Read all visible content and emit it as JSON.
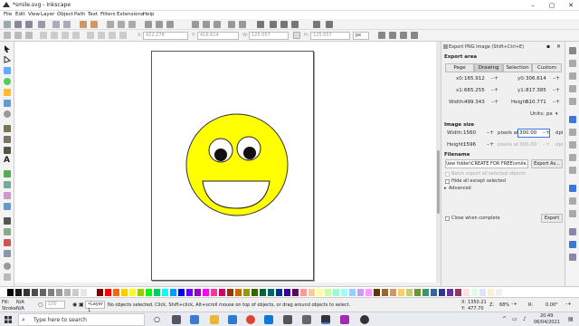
{
  "window": {
    "title": "*smile.svg - Inkscape",
    "min": "–",
    "max": "▢",
    "close": "✕"
  },
  "menu": [
    "File",
    "Edit",
    "View",
    "Layer",
    "Object",
    "Path",
    "Text",
    "Filters",
    "Extensions",
    "Help"
  ],
  "toolctrl": {
    "x": "422.278",
    "y": "416.614",
    "w": "125.057",
    "h": "125.057",
    "unit": "px"
  },
  "panel": {
    "title": "Export PNG Image (Shift+Ctrl+E)",
    "export_area_label": "Export area",
    "area_tabs": [
      "Page",
      "Drawing",
      "Selection",
      "Custom"
    ],
    "x0_label": "x0:",
    "x0": "165.912",
    "y0_label": "y0:",
    "y0": "306.614",
    "x1_label": "x1:",
    "x1": "665.255",
    "y1_label": "y1:",
    "y1": "817.385",
    "width_label": "Width:",
    "width": "499.343",
    "height_label": "Height:",
    "height": "510.771",
    "units_label": "Units:",
    "units": "px",
    "image_size_label": "Image size",
    "img_width_label": "Width:",
    "img_width": "1560",
    "img_height_label": "Height:",
    "img_height": "1596",
    "pixels_at": "pixels at",
    "dpi": "300.00",
    "dpi2": "300.00",
    "dpi_unit": "dpi",
    "filename_label": "Filename",
    "filename": "\\iew folder\\CREATE FOR FREE\\smile.png",
    "export_as": "Export As...",
    "batch_export": "Batch export all selected objects",
    "hide_except": "Hide all except selected",
    "advanced": "Advanced",
    "close_when_complete": "Close when complete",
    "export_btn": "Export"
  },
  "status": {
    "fill_label": "Fill:",
    "fill_val": "N/A",
    "stroke_label": "Stroke:",
    "stroke_val": "N/A",
    "opacity": "100",
    "layer": "•Layer 1",
    "message": "No objects selected. Click, Shift+click, Alt+scroll mouse on top of objects, or drag around objects to select.",
    "x_label": "X:",
    "x_val": "1350.21",
    "y_label": "Y:",
    "y_val": "477.70",
    "z_label": "Z:",
    "zoom": "68%",
    "r_label": "R:",
    "rotation": "0.00°"
  },
  "taskbar": {
    "search_placeholder": "Type here to search",
    "time": "20:49",
    "date": "06/04/2021"
  },
  "colors": {
    "accent": "#3b78d8",
    "face": "#ffff00"
  }
}
